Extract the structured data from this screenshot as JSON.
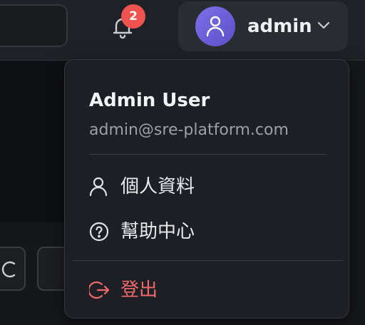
{
  "header": {
    "notifications": {
      "count": "2",
      "icon": "bell-icon"
    },
    "user": {
      "name": "admin",
      "avatar_icon": "user-icon",
      "dropdown_icon": "chevron-down-icon"
    }
  },
  "user_menu": {
    "display_name": "Admin User",
    "email": "admin@sre-platform.com",
    "items": [
      {
        "label": "個人資料",
        "icon": "user-icon"
      },
      {
        "label": "幫助中心",
        "icon": "help-circle-icon"
      }
    ],
    "logout": {
      "label": "登出",
      "icon": "logout-icon",
      "color": "#f06b6b"
    }
  },
  "toolbar": {
    "refresh_icon": "refresh-icon"
  },
  "colors": {
    "badge": "#ef5350",
    "avatar": "#6a5fd8",
    "danger": "#f06b6b"
  }
}
